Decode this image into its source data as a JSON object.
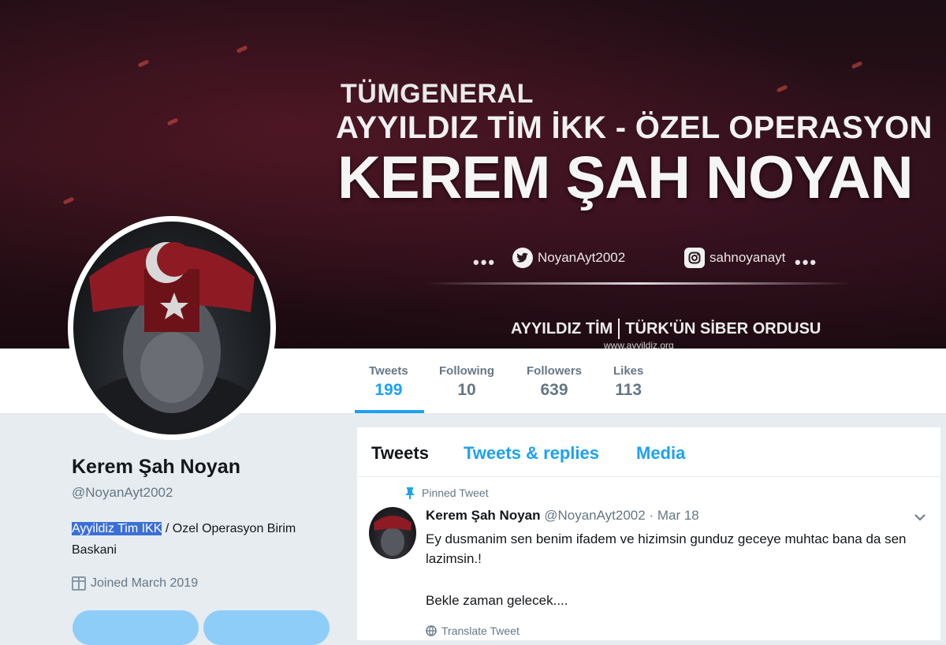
{
  "banner": {
    "line1": "TÜMGENERAL",
    "line2": "AYYILDIZ TİM İKK - ÖZEL OPERASYON",
    "line3": "KEREM ŞAH NOYAN",
    "dots": "•••",
    "twitter_handle": "NoyanAyt2002",
    "instagram_handle": "sahnoyanayt",
    "footer_left": "AYYILDIZ TİM",
    "footer_right": "TÜRK'ÜN SİBER ORDUSU",
    "url": "www.ayyildiz.org"
  },
  "stats": [
    {
      "label": "Tweets",
      "value": "199"
    },
    {
      "label": "Following",
      "value": "10"
    },
    {
      "label": "Followers",
      "value": "639"
    },
    {
      "label": "Likes",
      "value": "113"
    }
  ],
  "profile": {
    "name": "Kerem Şah Noyan",
    "handle": "@NoyanAyt2002",
    "bio_highlight": "Ayyildiz Tim IKK",
    "bio_rest": " / Ozel Operasyon Birim Baskani",
    "joined": "Joined March 2019"
  },
  "tabs": [
    "Tweets",
    "Tweets & replies",
    "Media"
  ],
  "tweet": {
    "pinned_label": "Pinned Tweet",
    "author": "Kerem Şah Noyan",
    "handle": "@NoyanAyt2002",
    "date": "· Mar 18",
    "text": "Ey dusmanim sen benim ifadem ve hizimsin gunduz geceye muhtac bana da sen lazimsin.!",
    "text2": "Bekle zaman gelecek....",
    "translate": "Translate Tweet"
  },
  "colors": {
    "accent": "#1da1f2",
    "secondary_text": "#657786",
    "background": "#e6ecf0"
  }
}
